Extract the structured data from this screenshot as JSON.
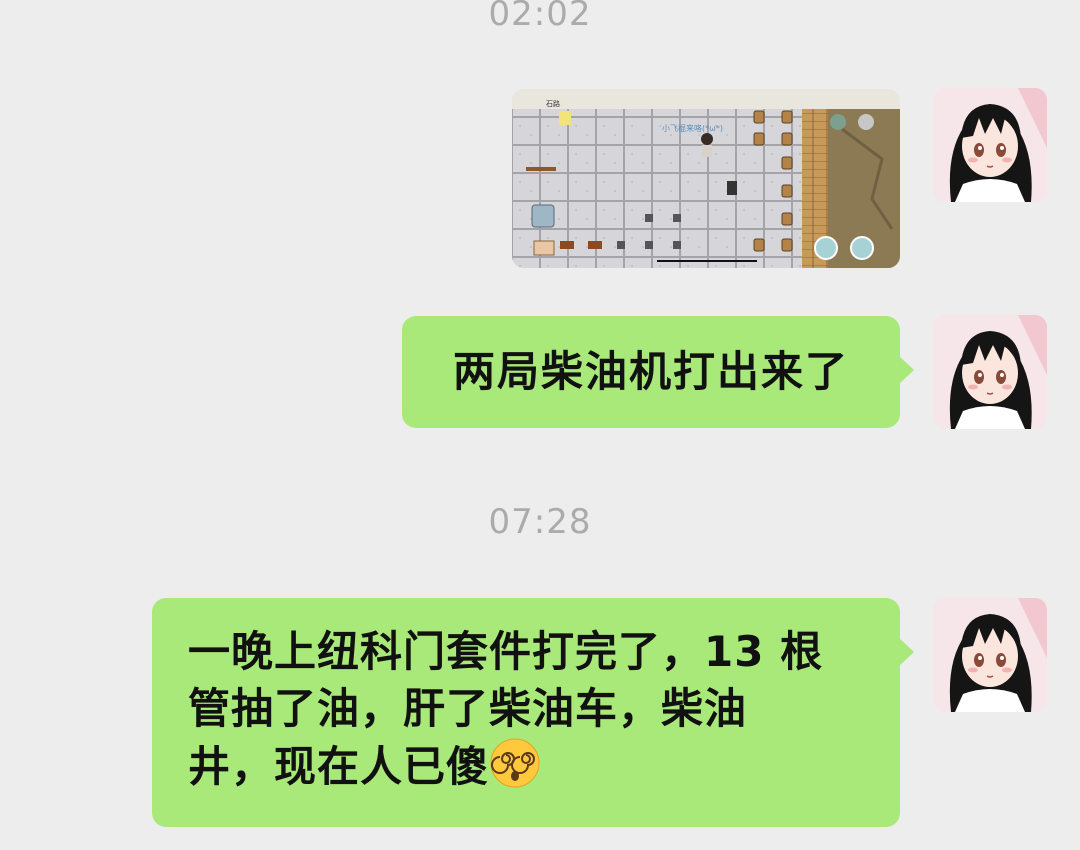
{
  "messages": [
    {
      "type": "timestamp",
      "text": "02:02"
    },
    {
      "type": "image",
      "sender": "self",
      "content": "game-screenshot",
      "game": {
        "top_label": "石路",
        "player_name": "小飞棍来咯(*ω*)"
      }
    },
    {
      "type": "text",
      "sender": "self",
      "text": "两局柴油机打出来了"
    },
    {
      "type": "timestamp",
      "text": "07:28"
    },
    {
      "type": "text",
      "sender": "self",
      "lines": [
        "一晚上纽科门套件打完了，13 根",
        "管抽了油，肝了柴油车，柴油",
        "井，现在人已傻"
      ],
      "emoji": "dizzy-face-emoji"
    }
  ],
  "colors": {
    "background": "#ededed",
    "bubble": "#a9e97a",
    "timestamp": "#ababab"
  },
  "icons": {
    "avatar": "anime-girl-avatar"
  }
}
